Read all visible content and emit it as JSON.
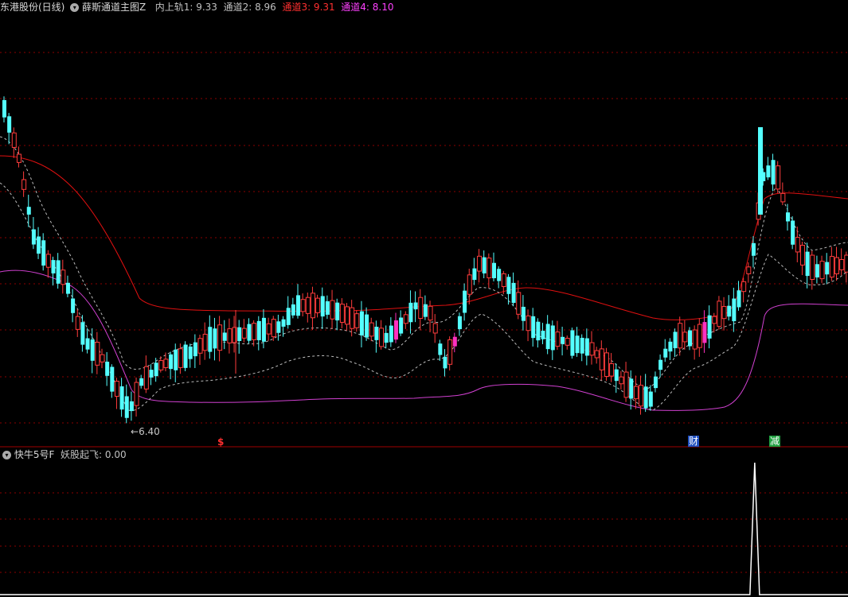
{
  "header": {
    "stock": "东港股份(日线)",
    "indicator": "薛斯通道主图Z",
    "series": [
      {
        "label": "内上轨1: 9.33",
        "color": "#c0c0c0"
      },
      {
        "label": "通道2: 8.96",
        "color": "#c0c0c0"
      },
      {
        "label": "通道3: 9.31",
        "color": "#ff3030"
      },
      {
        "label": "通道4: 8.10",
        "color": "#ff40ff"
      }
    ]
  },
  "subpanel": {
    "indicator": "快牛5号F",
    "series_label": "妖股起飞: 0.00"
  },
  "markers": {
    "low_label": "6.40",
    "tag_dollar": "$",
    "tag_cai": "财",
    "tag_jian": "减"
  },
  "colors": {
    "up": "#ff3c3c",
    "down": "#54ffff",
    "upper_channel": "#e01010",
    "lower_channel": "#d040d0",
    "inner_band": "#c0c0c0",
    "grid": "#8b0000",
    "highlight": "#ff30c0"
  },
  "chart_data": {
    "type": "candlestick",
    "price_ylim": [
      6.3,
      11.2
    ],
    "low_marker_value": 6.4,
    "candles_ohlc_approx": [
      [
        10.2,
        10.4,
        9.9,
        10.0
      ],
      [
        10.0,
        10.2,
        9.6,
        9.7
      ],
      [
        9.7,
        9.8,
        9.2,
        9.3
      ],
      [
        9.3,
        9.4,
        8.8,
        8.9
      ],
      [
        8.9,
        9.1,
        8.5,
        8.7
      ],
      [
        8.7,
        8.8,
        8.3,
        8.4
      ],
      [
        8.4,
        8.6,
        8.1,
        8.5
      ],
      [
        8.5,
        8.6,
        8.0,
        8.1
      ],
      [
        8.1,
        8.3,
        7.4,
        7.5
      ],
      [
        7.5,
        7.8,
        7.2,
        7.6
      ],
      [
        7.6,
        7.7,
        7.1,
        7.2
      ],
      [
        7.2,
        7.3,
        6.8,
        6.9
      ],
      [
        6.9,
        7.1,
        6.4,
        6.5
      ],
      [
        6.5,
        6.9,
        6.45,
        6.8
      ],
      [
        6.8,
        7.0,
        6.7,
        6.9
      ],
      [
        6.9,
        7.2,
        6.8,
        7.1
      ],
      [
        7.1,
        7.3,
        6.9,
        7.0
      ],
      [
        7.0,
        7.4,
        6.9,
        7.3
      ],
      [
        7.3,
        7.5,
        7.1,
        7.2
      ],
      [
        7.2,
        7.4,
        7.0,
        7.3
      ],
      [
        7.3,
        8.1,
        7.2,
        7.4
      ],
      [
        7.4,
        7.6,
        7.2,
        7.3
      ],
      [
        7.3,
        7.5,
        7.1,
        7.4
      ],
      [
        7.4,
        7.8,
        7.3,
        7.7
      ],
      [
        7.7,
        7.9,
        7.5,
        7.8
      ],
      [
        7.8,
        7.9,
        7.5,
        7.6
      ],
      [
        7.6,
        7.8,
        7.4,
        7.5
      ],
      [
        7.5,
        7.6,
        7.2,
        7.3
      ],
      [
        7.3,
        7.6,
        7.2,
        7.5
      ],
      [
        7.5,
        7.8,
        7.4,
        7.7
      ],
      [
        7.7,
        8.0,
        7.6,
        7.9
      ],
      [
        7.9,
        8.2,
        7.8,
        8.1
      ],
      [
        8.1,
        8.3,
        7.7,
        7.8
      ],
      [
        7.8,
        7.9,
        7.3,
        7.4
      ],
      [
        7.4,
        7.5,
        7.1,
        7.2
      ],
      [
        7.2,
        7.3,
        6.9,
        7.0
      ],
      [
        7.0,
        7.2,
        6.9,
        7.1
      ],
      [
        7.1,
        7.3,
        7.0,
        7.2
      ],
      [
        7.2,
        7.4,
        7.1,
        7.3
      ],
      [
        7.3,
        7.6,
        7.2,
        7.5
      ],
      [
        7.5,
        7.7,
        7.4,
        7.6
      ],
      [
        7.6,
        7.7,
        7.3,
        7.4
      ],
      [
        7.4,
        7.5,
        7.1,
        7.2
      ],
      [
        7.2,
        7.3,
        6.95,
        7.0
      ],
      [
        7.0,
        7.2,
        6.9,
        7.1
      ]
    ],
    "subpanel_series": {
      "name": "妖股起飞",
      "peak_position_fraction": 0.89,
      "current_value": 0.0
    }
  }
}
